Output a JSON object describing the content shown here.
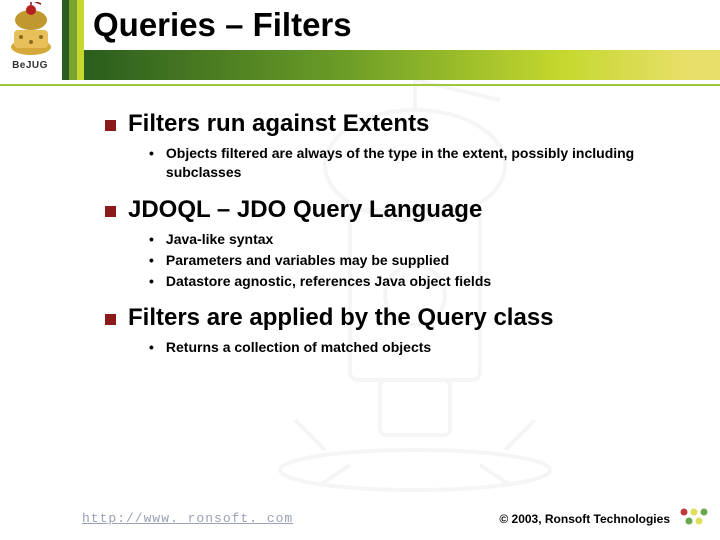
{
  "logo": {
    "brand_text": "BeJUG"
  },
  "title": "Queries – Filters",
  "bullets": [
    {
      "heading": "Filters run against Extents",
      "subs": [
        "Objects filtered are always of the type in the extent, possibly including subclasses"
      ]
    },
    {
      "heading": "JDOQL – JDO Query Language",
      "subs": [
        "Java-like syntax",
        "Parameters and variables may be supplied",
        "Datastore agnostic, references Java object fields"
      ]
    },
    {
      "heading": "Filters are applied by the Query class",
      "subs": [
        "Returns a collection of matched objects"
      ]
    }
  ],
  "footer": {
    "url": "http://www. ronsoft. com",
    "copyright": "© 2003, Ronsoft Technologies"
  }
}
